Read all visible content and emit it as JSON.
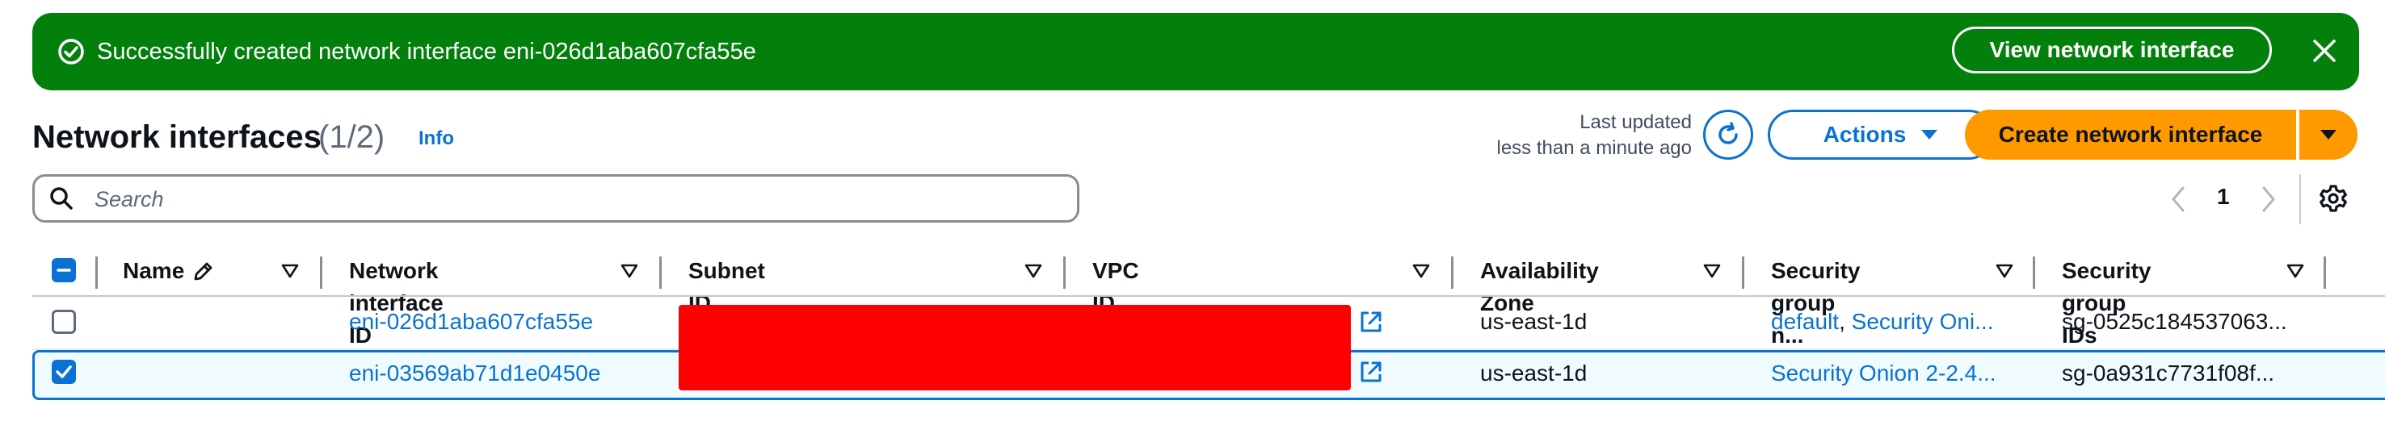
{
  "flash": {
    "message": "Successfully created network interface eni-026d1aba607cfa55e",
    "view_button": "View network interface"
  },
  "header": {
    "title": "Network interfaces",
    "count": "(1/2)",
    "info": "Info",
    "last_updated_label": "Last updated",
    "last_updated_value": "less than a minute ago",
    "actions_label": "Actions",
    "create_label": "Create network interface"
  },
  "search": {
    "placeholder": "Search",
    "value": ""
  },
  "pagination": {
    "current_page": "1"
  },
  "table": {
    "columns": {
      "name": "Name",
      "network_interface_id": "Network interface ID",
      "subnet_id": "Subnet ID",
      "vpc_id": "VPC ID",
      "availability_zone": "Availability Zone",
      "security_group_names": "Security group n...",
      "security_group_ids": "Security group IDs"
    },
    "rows": [
      {
        "selected": false,
        "name": "",
        "network_interface_id": "eni-026d1aba607cfa55e",
        "availability_zone": "us-east-1d",
        "security_group_names_a": "default",
        "security_group_names_sep": ", ",
        "security_group_names_b": "Security Oni...",
        "security_group_ids": "sg-0525c184537063..."
      },
      {
        "selected": true,
        "name": "",
        "network_interface_id": "eni-03569ab71d1e0450e",
        "availability_zone": "us-east-1d",
        "security_group_names_a": "Security Onion 2-2.4...",
        "security_group_ids": "sg-0a931c7731f08f..."
      }
    ]
  },
  "colors": {
    "flash_success": "#037f0c",
    "primary_button": "#ff9900",
    "link": "#0972d3",
    "redaction": "#ff0000",
    "selected_row_bg": "#f0fbff"
  }
}
